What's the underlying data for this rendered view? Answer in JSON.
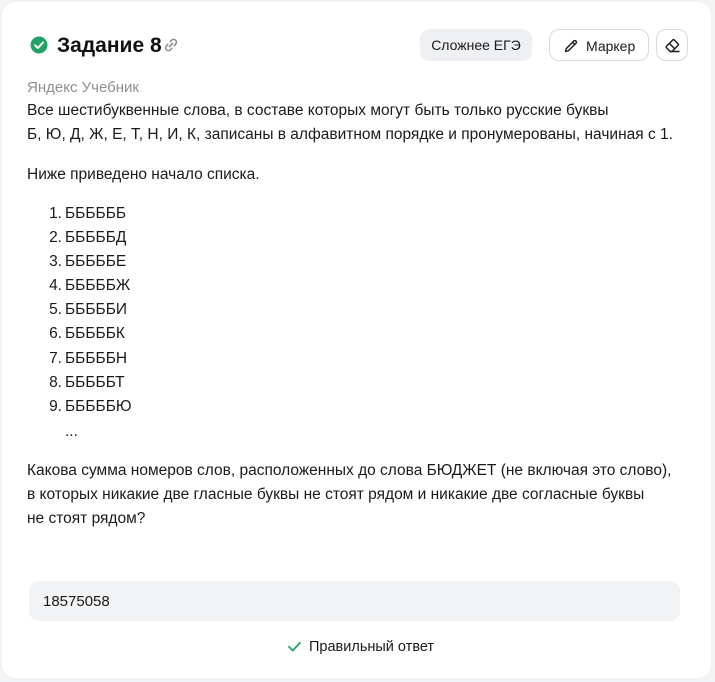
{
  "header": {
    "title": "Задание 8",
    "tag_label": "Сложнее ЕГЭ",
    "marker_label": "Маркер",
    "status_color": "#21a366"
  },
  "source": "Яндекс Учебник",
  "task": {
    "intro_line1": "Все шестибуквенные слова, в составе которых могут быть только русские буквы",
    "intro_line2": "Б, Ю, Д, Ж, Е, Т, Н, И, К, записаны в алфавитном порядке и пронумерованы, начиная с 1.",
    "list_intro": "Ниже приведено начало списка.",
    "list": [
      {
        "n": "1.",
        "word": "ББББББ"
      },
      {
        "n": "2.",
        "word": "БББББД"
      },
      {
        "n": "3.",
        "word": "БББББЕ"
      },
      {
        "n": "4.",
        "word": "БББББЖ"
      },
      {
        "n": "5.",
        "word": "БББББИ"
      },
      {
        "n": "6.",
        "word": "БББББК"
      },
      {
        "n": "7.",
        "word": "БББББН"
      },
      {
        "n": "8.",
        "word": "БББББТ"
      },
      {
        "n": "9.",
        "word": "БББББЮ"
      }
    ],
    "ellipsis": "...",
    "question_line1": "Какова сумма номеров слов, расположенных до слова БЮДЖЕТ (не включая это слово),",
    "question_line2": "в которых никакие две гласные буквы не стоят рядом и никакие две согласные буквы",
    "question_line3": "не стоят рядом?"
  },
  "answer": {
    "value": "18575058",
    "result_label": "Правильный ответ",
    "result_color": "#21a366"
  },
  "icons": {
    "status": "check-circle-icon",
    "link": "link-icon",
    "marker": "pencil-icon",
    "eraser": "eraser-icon",
    "result": "checkmark-icon"
  }
}
